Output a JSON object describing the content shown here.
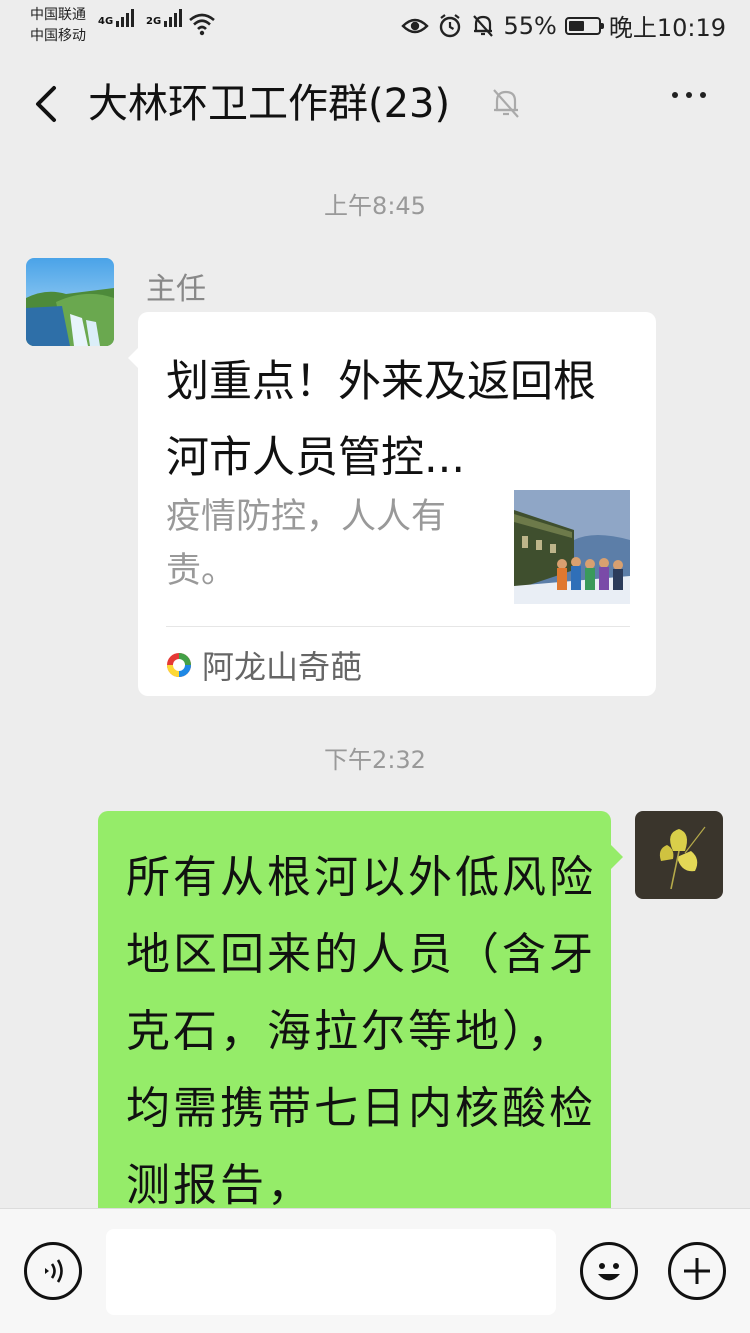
{
  "status_bar": {
    "carrier1": "中国联通",
    "carrier2": "中国移动",
    "net1": "4G",
    "net2": "2G",
    "battery": "55%",
    "battery_level": 0.55,
    "time": "晚上10:19"
  },
  "header": {
    "title": "大林环卫工作群(23)"
  },
  "messages": {
    "ts1": "上午8:45",
    "sender": "主任",
    "card_title": "划重点！外来及返回根河市人员管控...",
    "card_desc": "疫情防控，人人有责。",
    "card_source": "阿龙山奇葩",
    "ts2": "下午2:32",
    "my_text": "所有从根河以外低风险地区回来的人员（含牙克石，海拉尔等地），均需携带七日内核酸检测报告，"
  },
  "input_bar": {
    "value": ""
  },
  "colors": {
    "bubble_green": "#95ec69",
    "background": "#ededed"
  },
  "icons": [
    "back-arrow-icon",
    "mute-bell-icon",
    "more-icon",
    "voice-icon",
    "emoji-icon",
    "plus-icon"
  ]
}
